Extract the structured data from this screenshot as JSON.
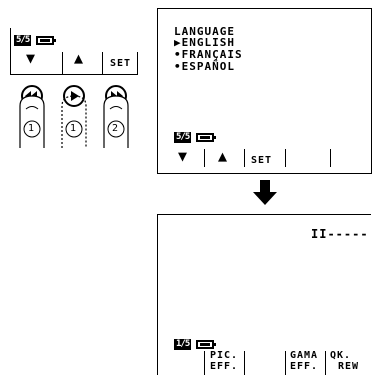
{
  "mini_bar": {
    "page_badge": "5/5",
    "set_label": "SET",
    "down_icon": "triangle-down",
    "up_icon": "triangle-up"
  },
  "buttons": {
    "rewind_icon": "rewind",
    "play_icon": "play",
    "forward_icon": "fast-forward",
    "finger1_num": "1",
    "finger2_num": "1",
    "finger3_num": "2"
  },
  "language_panel": {
    "heading": "LANGUAGE",
    "options": [
      {
        "label": "ENGLISH",
        "marker": "▶"
      },
      {
        "label": "FRANÇAIS",
        "marker": "•"
      },
      {
        "label": "ESPAÑOL",
        "marker": "•"
      }
    ],
    "page_badge": "5/5",
    "set_label": "SET"
  },
  "arrow": {
    "icon": "arrow-down"
  },
  "display_panel": {
    "status_indicator": "II-----",
    "page_badge": "1/5",
    "softkeys": [
      {
        "line1": "PIC.",
        "line2": "EFF."
      },
      {
        "line1": "GAMA",
        "line2": "EFF."
      },
      {
        "line1": "QK.",
        "line2": "REW"
      }
    ]
  }
}
